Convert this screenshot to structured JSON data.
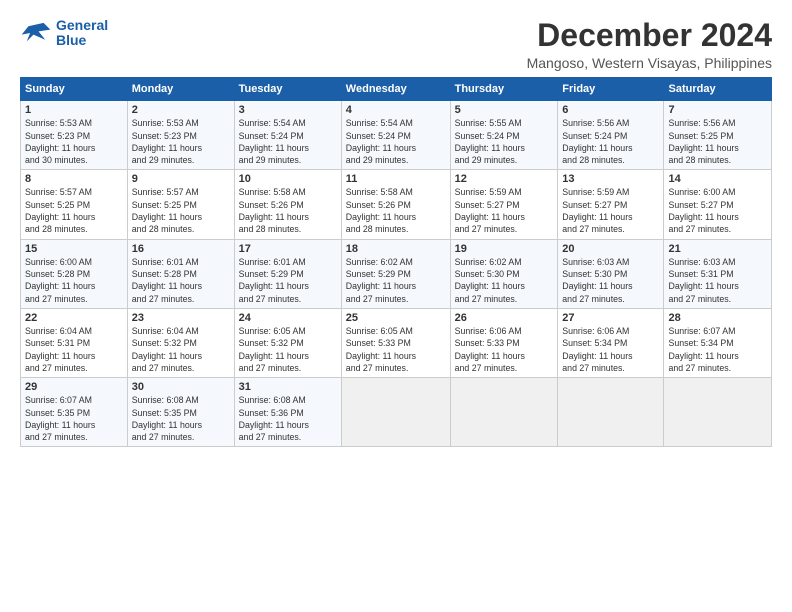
{
  "logo": {
    "line1": "General",
    "line2": "Blue"
  },
  "title": "December 2024",
  "subtitle": "Mangoso, Western Visayas, Philippines",
  "days_header": [
    "Sunday",
    "Monday",
    "Tuesday",
    "Wednesday",
    "Thursday",
    "Friday",
    "Saturday"
  ],
  "weeks": [
    [
      {
        "day": "1",
        "info": "Sunrise: 5:53 AM\nSunset: 5:23 PM\nDaylight: 11 hours\nand 30 minutes."
      },
      {
        "day": "2",
        "info": "Sunrise: 5:53 AM\nSunset: 5:23 PM\nDaylight: 11 hours\nand 29 minutes."
      },
      {
        "day": "3",
        "info": "Sunrise: 5:54 AM\nSunset: 5:24 PM\nDaylight: 11 hours\nand 29 minutes."
      },
      {
        "day": "4",
        "info": "Sunrise: 5:54 AM\nSunset: 5:24 PM\nDaylight: 11 hours\nand 29 minutes."
      },
      {
        "day": "5",
        "info": "Sunrise: 5:55 AM\nSunset: 5:24 PM\nDaylight: 11 hours\nand 29 minutes."
      },
      {
        "day": "6",
        "info": "Sunrise: 5:56 AM\nSunset: 5:24 PM\nDaylight: 11 hours\nand 28 minutes."
      },
      {
        "day": "7",
        "info": "Sunrise: 5:56 AM\nSunset: 5:25 PM\nDaylight: 11 hours\nand 28 minutes."
      }
    ],
    [
      {
        "day": "8",
        "info": "Sunrise: 5:57 AM\nSunset: 5:25 PM\nDaylight: 11 hours\nand 28 minutes."
      },
      {
        "day": "9",
        "info": "Sunrise: 5:57 AM\nSunset: 5:25 PM\nDaylight: 11 hours\nand 28 minutes."
      },
      {
        "day": "10",
        "info": "Sunrise: 5:58 AM\nSunset: 5:26 PM\nDaylight: 11 hours\nand 28 minutes."
      },
      {
        "day": "11",
        "info": "Sunrise: 5:58 AM\nSunset: 5:26 PM\nDaylight: 11 hours\nand 28 minutes."
      },
      {
        "day": "12",
        "info": "Sunrise: 5:59 AM\nSunset: 5:27 PM\nDaylight: 11 hours\nand 27 minutes."
      },
      {
        "day": "13",
        "info": "Sunrise: 5:59 AM\nSunset: 5:27 PM\nDaylight: 11 hours\nand 27 minutes."
      },
      {
        "day": "14",
        "info": "Sunrise: 6:00 AM\nSunset: 5:27 PM\nDaylight: 11 hours\nand 27 minutes."
      }
    ],
    [
      {
        "day": "15",
        "info": "Sunrise: 6:00 AM\nSunset: 5:28 PM\nDaylight: 11 hours\nand 27 minutes."
      },
      {
        "day": "16",
        "info": "Sunrise: 6:01 AM\nSunset: 5:28 PM\nDaylight: 11 hours\nand 27 minutes."
      },
      {
        "day": "17",
        "info": "Sunrise: 6:01 AM\nSunset: 5:29 PM\nDaylight: 11 hours\nand 27 minutes."
      },
      {
        "day": "18",
        "info": "Sunrise: 6:02 AM\nSunset: 5:29 PM\nDaylight: 11 hours\nand 27 minutes."
      },
      {
        "day": "19",
        "info": "Sunrise: 6:02 AM\nSunset: 5:30 PM\nDaylight: 11 hours\nand 27 minutes."
      },
      {
        "day": "20",
        "info": "Sunrise: 6:03 AM\nSunset: 5:30 PM\nDaylight: 11 hours\nand 27 minutes."
      },
      {
        "day": "21",
        "info": "Sunrise: 6:03 AM\nSunset: 5:31 PM\nDaylight: 11 hours\nand 27 minutes."
      }
    ],
    [
      {
        "day": "22",
        "info": "Sunrise: 6:04 AM\nSunset: 5:31 PM\nDaylight: 11 hours\nand 27 minutes."
      },
      {
        "day": "23",
        "info": "Sunrise: 6:04 AM\nSunset: 5:32 PM\nDaylight: 11 hours\nand 27 minutes."
      },
      {
        "day": "24",
        "info": "Sunrise: 6:05 AM\nSunset: 5:32 PM\nDaylight: 11 hours\nand 27 minutes."
      },
      {
        "day": "25",
        "info": "Sunrise: 6:05 AM\nSunset: 5:33 PM\nDaylight: 11 hours\nand 27 minutes."
      },
      {
        "day": "26",
        "info": "Sunrise: 6:06 AM\nSunset: 5:33 PM\nDaylight: 11 hours\nand 27 minutes."
      },
      {
        "day": "27",
        "info": "Sunrise: 6:06 AM\nSunset: 5:34 PM\nDaylight: 11 hours\nand 27 minutes."
      },
      {
        "day": "28",
        "info": "Sunrise: 6:07 AM\nSunset: 5:34 PM\nDaylight: 11 hours\nand 27 minutes."
      }
    ],
    [
      {
        "day": "29",
        "info": "Sunrise: 6:07 AM\nSunset: 5:35 PM\nDaylight: 11 hours\nand 27 minutes."
      },
      {
        "day": "30",
        "info": "Sunrise: 6:08 AM\nSunset: 5:35 PM\nDaylight: 11 hours\nand 27 minutes."
      },
      {
        "day": "31",
        "info": "Sunrise: 6:08 AM\nSunset: 5:36 PM\nDaylight: 11 hours\nand 27 minutes."
      },
      null,
      null,
      null,
      null
    ]
  ]
}
